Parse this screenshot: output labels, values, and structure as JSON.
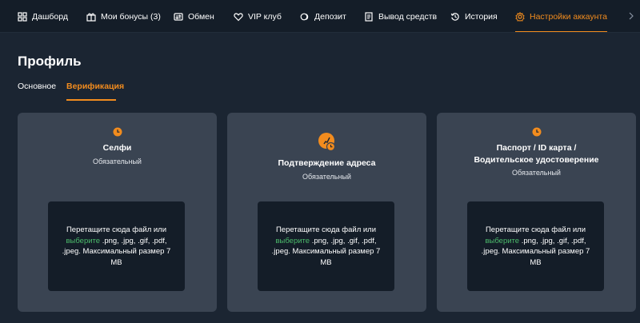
{
  "nav": {
    "items": [
      {
        "label": "Дашборд",
        "icon": "grid-icon"
      },
      {
        "label": "Мои бонусы (3)",
        "icon": "gift-icon"
      },
      {
        "label": "Обмен",
        "icon": "exchange-icon"
      },
      {
        "label": "VIP клуб",
        "icon": "heart-icon"
      },
      {
        "label": "Депозит",
        "icon": "coins-icon"
      },
      {
        "label": "Вывод средств",
        "icon": "receipt-icon"
      },
      {
        "label": "История",
        "icon": "history-icon"
      },
      {
        "label": "Настройки аккаунта",
        "icon": "gear-icon",
        "active": true
      }
    ]
  },
  "page": {
    "title": "Профиль",
    "tabs": [
      {
        "label": "Основное",
        "active": false
      },
      {
        "label": "Верификация",
        "active": true
      }
    ]
  },
  "cards": [
    {
      "title_lines": [
        "Селфи"
      ],
      "subtitle": "Обязательный",
      "icon": "clock-icon",
      "drop": {
        "before": "Перетащите сюда файл или",
        "link": "выберите",
        "after": ".png, .jpg, .gif, .pdf, .jpeg. Максимальный размер 7 MB"
      }
    },
    {
      "title_lines": [
        "Подтверждение адреса"
      ],
      "subtitle": "Обязательный",
      "icon": "address-pending-icon",
      "drop": {
        "before": "Перетащите сюда файл или",
        "link": "выберите",
        "after": ".png, .jpg, .gif, .pdf, .jpeg. Максимальный размер 7 MB"
      }
    },
    {
      "title_lines": [
        "Паспорт / ID карта /",
        "Водительское удостоверение"
      ],
      "subtitle": "Обязательный",
      "icon": "clock-icon",
      "drop": {
        "before": "Перетащите сюда файл или",
        "link": "выберите",
        "after": ".png, .jpg, .gif, .pdf, .jpeg. Максимальный размер 7 MB"
      }
    }
  ],
  "colors": {
    "accent": "#f28c1e",
    "link": "#4cbb6b",
    "background": "#1b2532",
    "card": "#3a4452",
    "dropzone": "#141d28"
  }
}
